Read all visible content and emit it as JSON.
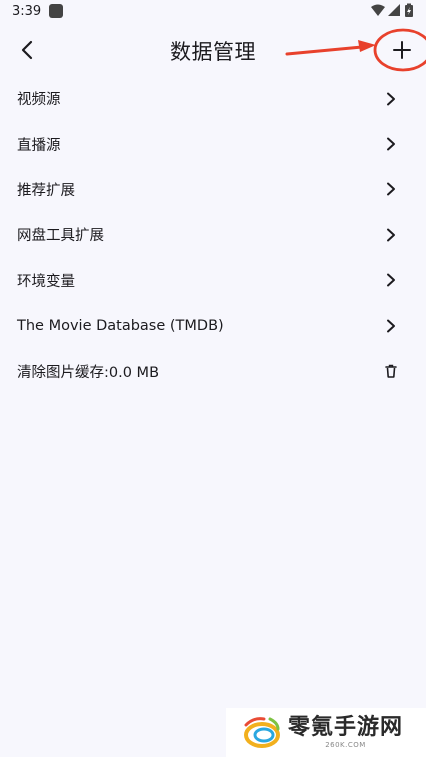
{
  "status_bar": {
    "time": "3:39",
    "icons": [
      "app-notification-icon",
      "wifi-icon",
      "signal-icon",
      "battery-charging-icon"
    ]
  },
  "header": {
    "title": "数据管理",
    "back_icon": "chevron-left-icon",
    "add_icon": "plus-icon"
  },
  "list": {
    "items": [
      {
        "label": "视频源",
        "trailing_icon": "chevron-right-icon"
      },
      {
        "label": "直播源",
        "trailing_icon": "chevron-right-icon"
      },
      {
        "label": "推荐扩展",
        "trailing_icon": "chevron-right-icon"
      },
      {
        "label": "网盘工具扩展",
        "trailing_icon": "chevron-right-icon"
      },
      {
        "label": "环境变量",
        "trailing_icon": "chevron-right-icon"
      },
      {
        "label": "The Movie Database (TMDB)",
        "trailing_icon": "chevron-right-icon"
      },
      {
        "label": "清除图片缓存:0.0 MB",
        "trailing_icon": "trash-icon"
      }
    ]
  },
  "annotation": {
    "color": "#e8412c"
  },
  "watermark": {
    "title": "零氪手游网",
    "subtitle": "260K.COM"
  }
}
